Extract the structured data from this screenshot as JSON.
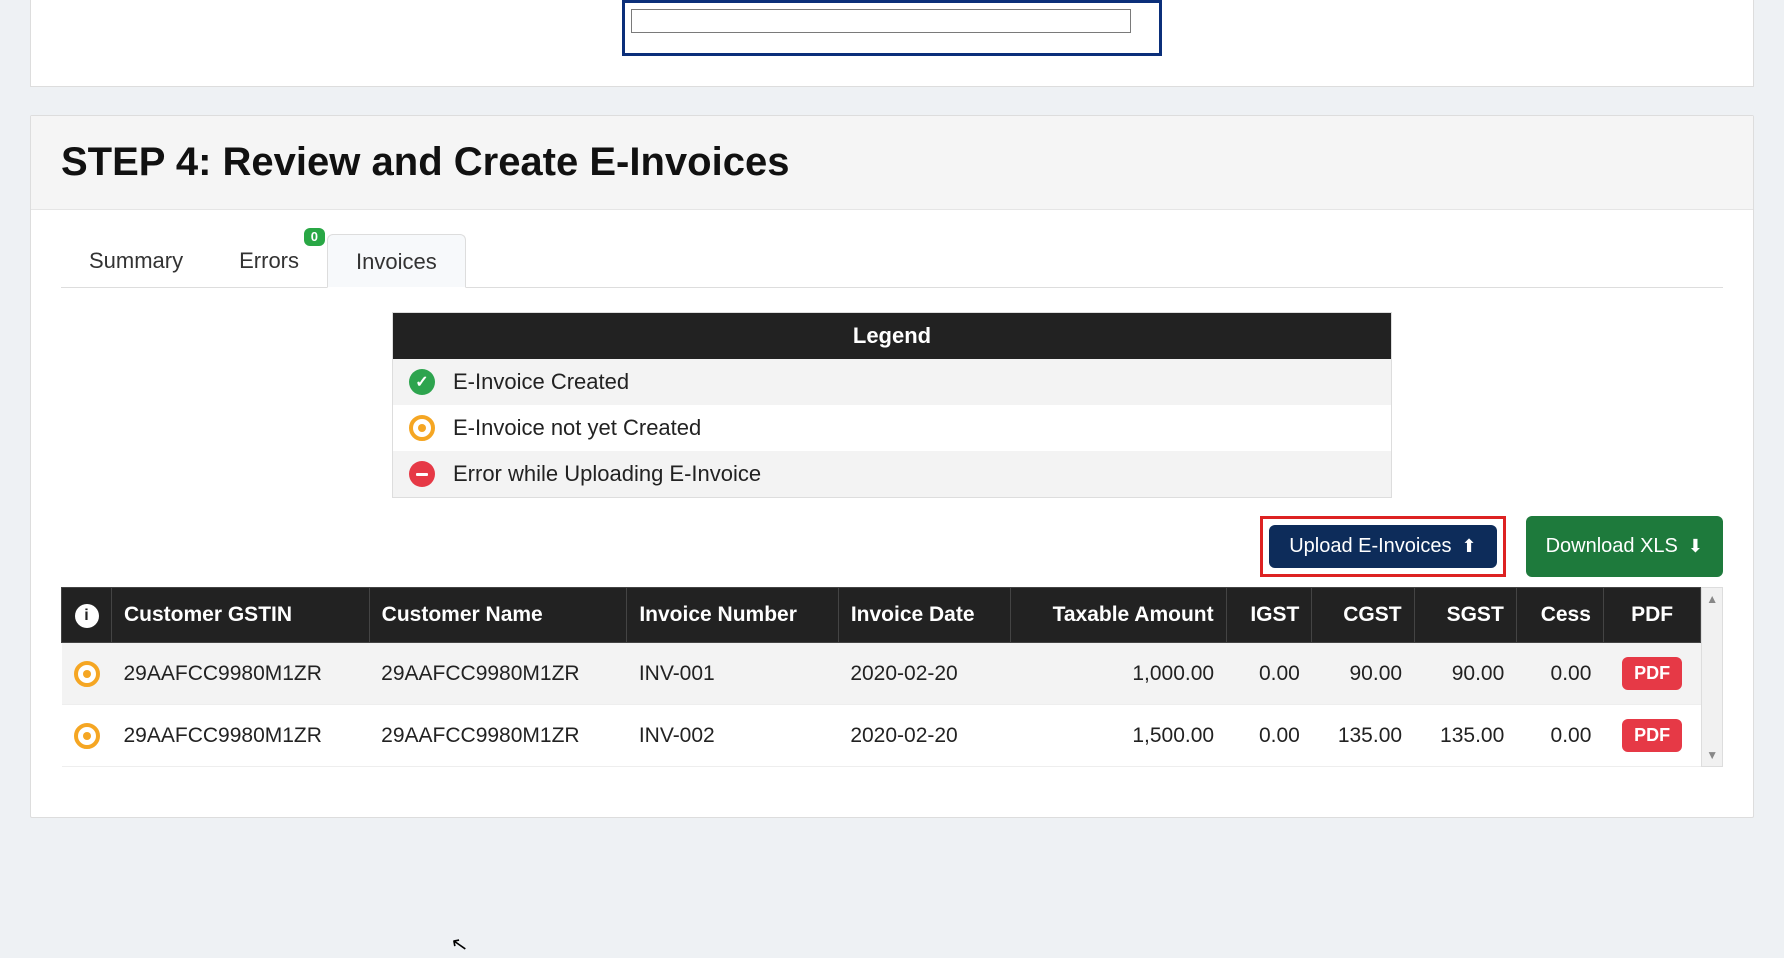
{
  "top_input": {
    "value": ""
  },
  "step": {
    "title": "STEP 4: Review and Create E-Invoices"
  },
  "tabs": {
    "summary": "Summary",
    "errors": "Errors",
    "errors_badge": "0",
    "invoices": "Invoices"
  },
  "legend": {
    "header": "Legend",
    "created": "E-Invoice Created",
    "pending": "E-Invoice not yet Created",
    "error": "Error while Uploading E-Invoice"
  },
  "actions": {
    "upload": "Upload E-Invoices",
    "download": "Download XLS"
  },
  "table": {
    "headers": {
      "info": "i",
      "gstin": "Customer GSTIN",
      "name": "Customer Name",
      "invno": "Invoice Number",
      "date": "Invoice Date",
      "taxable": "Taxable Amount",
      "igst": "IGST",
      "cgst": "CGST",
      "sgst": "SGST",
      "cess": "Cess",
      "pdf": "PDF"
    },
    "rows": [
      {
        "status": "pending",
        "gstin": "29AAFCC9980M1ZR",
        "name": "29AAFCC9980M1ZR",
        "invno": "INV-001",
        "date": "2020-02-20",
        "taxable": "1,000.00",
        "igst": "0.00",
        "cgst": "90.00",
        "sgst": "90.00",
        "cess": "0.00",
        "pdf": "PDF"
      },
      {
        "status": "pending",
        "gstin": "29AAFCC9980M1ZR",
        "name": "29AAFCC9980M1ZR",
        "invno": "INV-002",
        "date": "2020-02-20",
        "taxable": "1,500.00",
        "igst": "0.00",
        "cgst": "135.00",
        "sgst": "135.00",
        "cess": "0.00",
        "pdf": "PDF"
      }
    ]
  }
}
